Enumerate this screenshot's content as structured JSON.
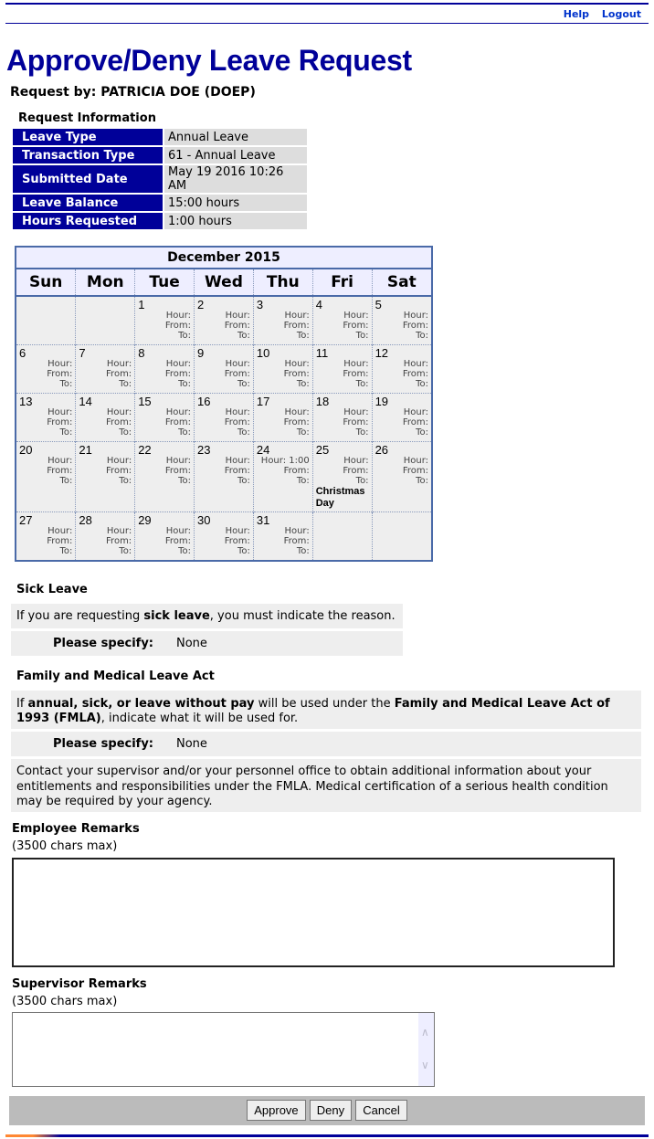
{
  "header": {
    "links": [
      "Help",
      "Logout"
    ],
    "title": "Approve/Deny Leave Request",
    "request_by": "Request by: PATRICIA DOE (DOEP)"
  },
  "request_info": {
    "title": "Request Information",
    "rows": [
      {
        "label": "Leave Type",
        "value": "Annual Leave"
      },
      {
        "label": "Transaction Type",
        "value": "61 - Annual Leave"
      },
      {
        "label": "Submitted Date",
        "value": "May 19 2016 10:26 AM"
      },
      {
        "label": "Leave Balance",
        "value": "15:00 hours"
      },
      {
        "label": "Hours Requested",
        "value": "1:00 hours"
      }
    ]
  },
  "calendar": {
    "title": "December 2015",
    "weekdays": [
      "Sun",
      "Mon",
      "Tue",
      "Wed",
      "Thu",
      "Fri",
      "Sat"
    ],
    "leading_blanks": 2,
    "days_in_month": 31,
    "labels": {
      "hour": "Hour:",
      "from": "From:",
      "to": "To:"
    },
    "hours": {
      "24": "1:00"
    },
    "holidays": {
      "25": "Christmas Day"
    }
  },
  "sick_leave": {
    "title": "Sick Leave",
    "text_pre": "If you are requesting ",
    "text_bold": "sick leave",
    "text_post": ", you must indicate the reason.",
    "specify_label": "Please specify:",
    "specify_value": "None"
  },
  "fmla": {
    "title": "Family and Medical Leave Act",
    "text_1": "If ",
    "bold_1": "annual, sick, or leave without pay",
    "text_2": " will be used under the ",
    "bold_2": "Family and Medical Leave Act of 1993 (FMLA)",
    "text_3": ", indicate what it will be used for.",
    "specify_label": "Please specify:",
    "specify_value": "None",
    "notice": "Contact your supervisor and/or your personnel office to obtain additional information about your entitlements and responsibilities under the FMLA. Medical certification of a serious health condition may be required by your agency."
  },
  "employee_remarks": {
    "title": "Employee Remarks",
    "limit": "(3500 chars max)",
    "value": ""
  },
  "supervisor_remarks": {
    "title": "Supervisor Remarks",
    "limit": "(3500 chars max)",
    "value": ""
  },
  "buttons": {
    "approve": "Approve",
    "deny": "Deny",
    "cancel": "Cancel"
  }
}
